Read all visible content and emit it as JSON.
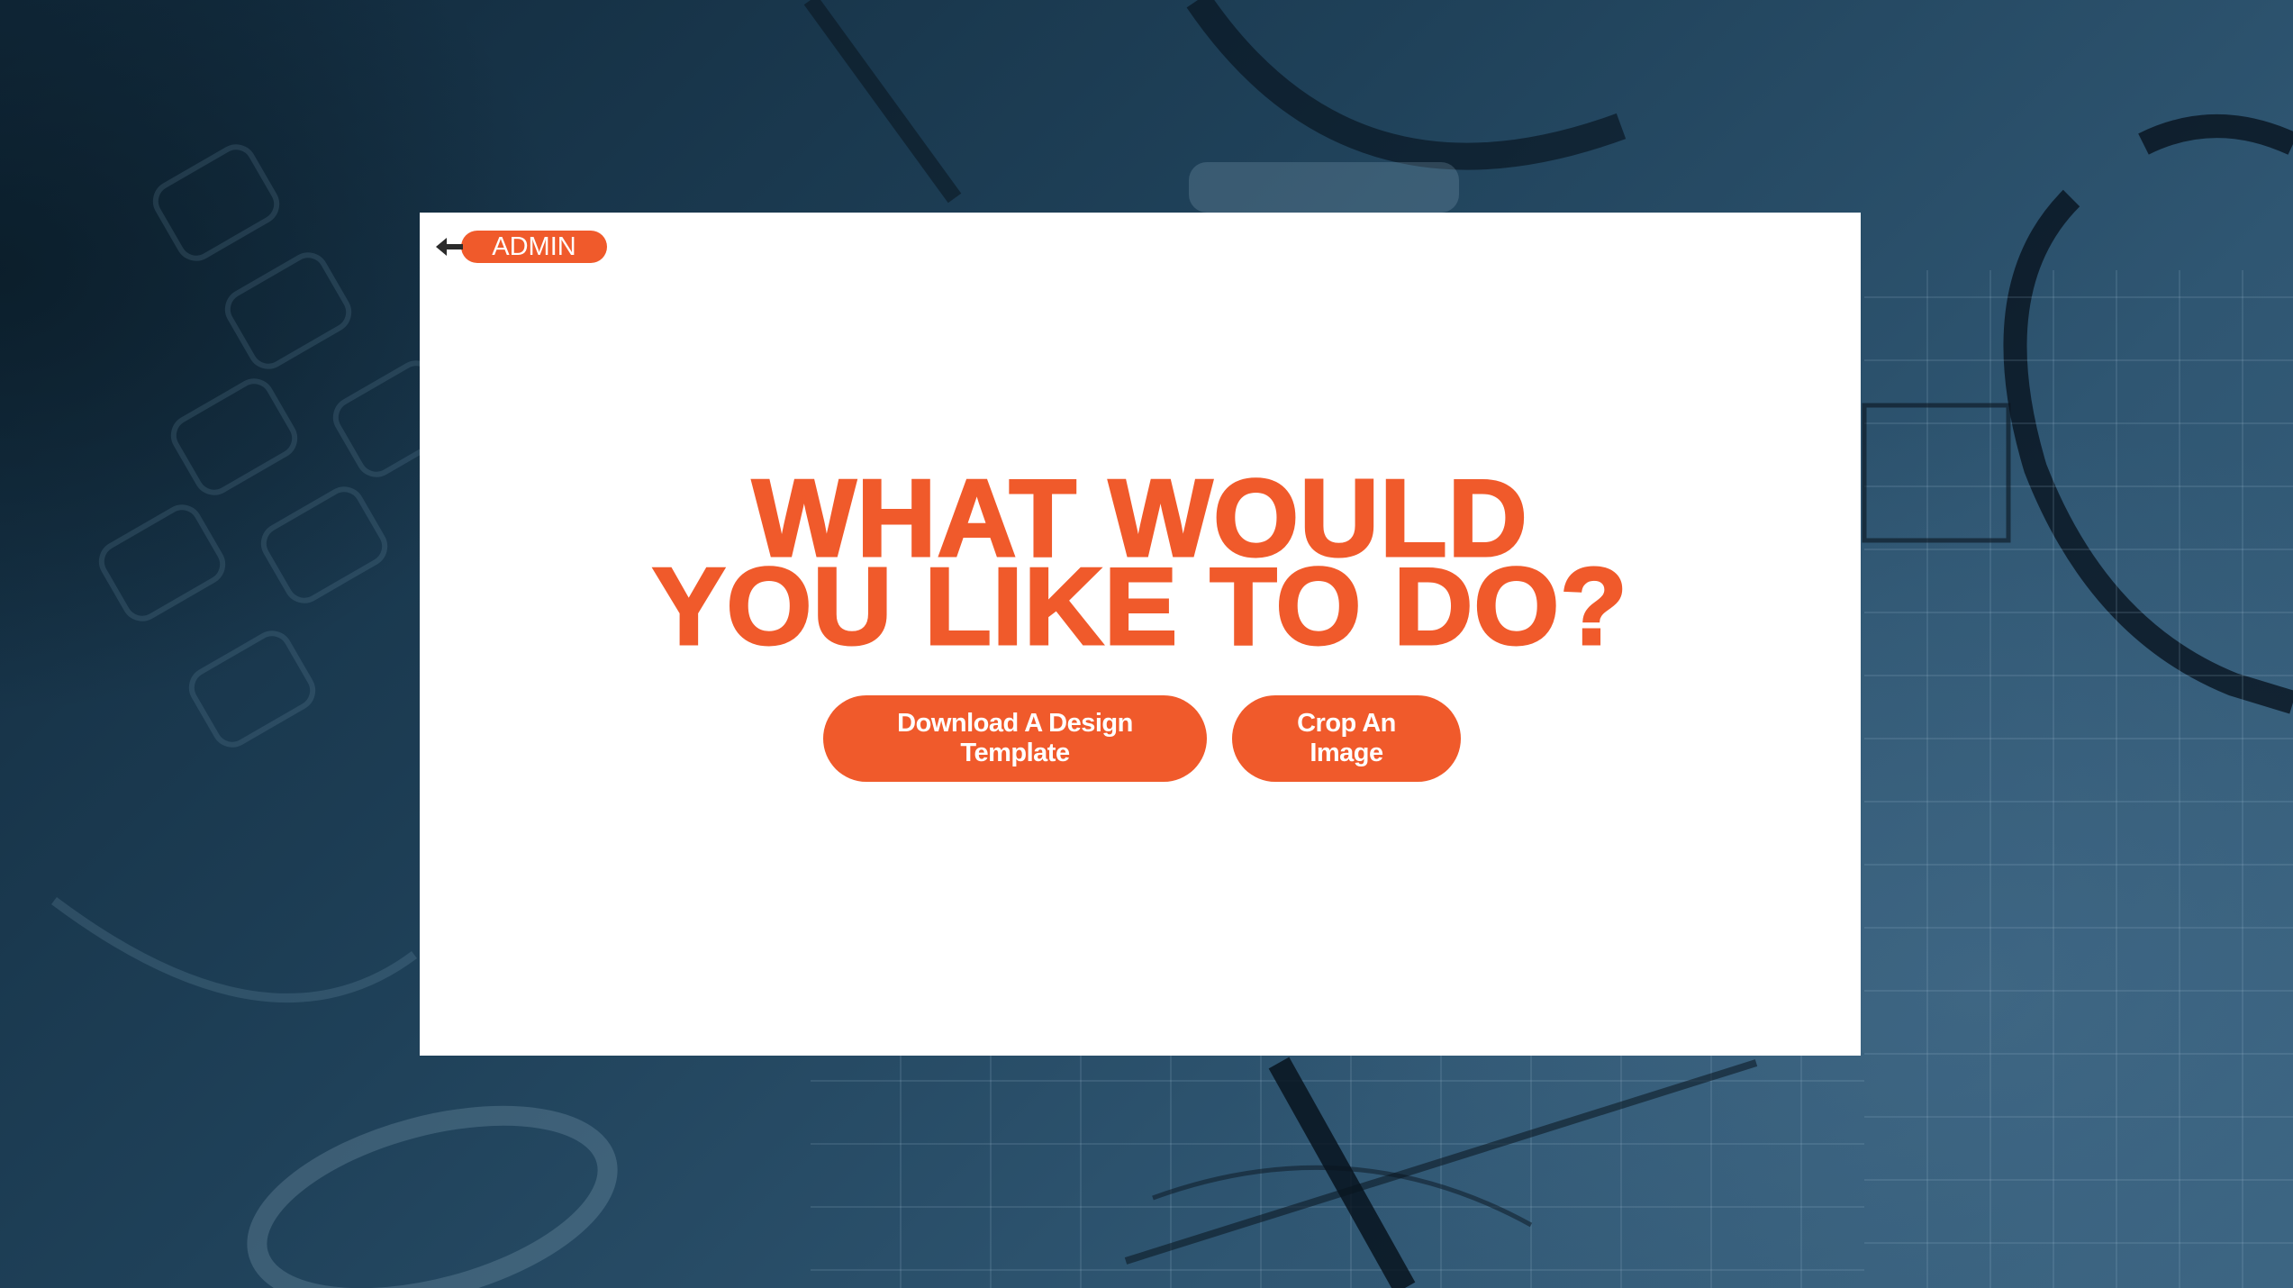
{
  "colors": {
    "accent": "#f05a2b",
    "modal_background": "#ffffff",
    "page_background": "#274a62"
  },
  "header": {
    "back_icon": "arrow-left-icon",
    "admin_label": "ADMIN"
  },
  "main": {
    "headline_line1": "WHAT WOULD",
    "headline_line2": "YOU LIKE TO DO?",
    "actions": {
      "download_label": "Download A Design Template",
      "crop_label": "Crop An Image"
    }
  }
}
